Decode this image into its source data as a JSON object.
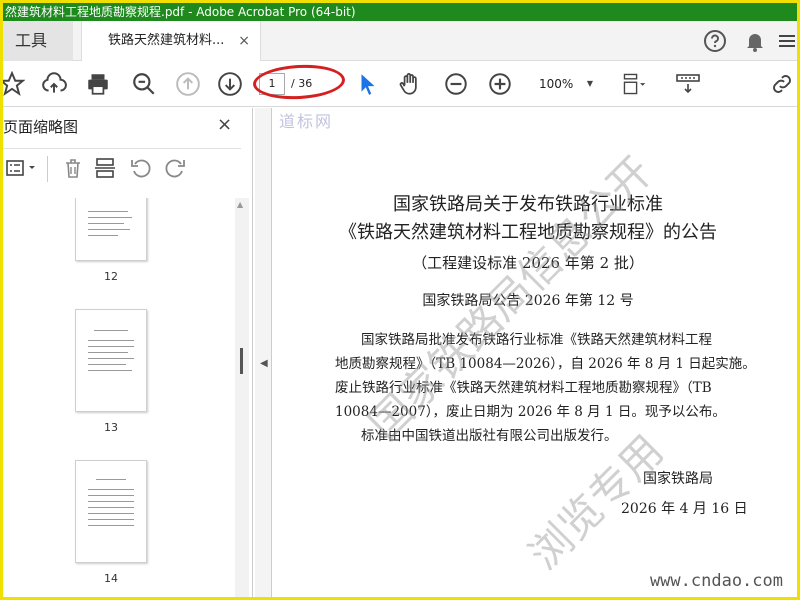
{
  "window": {
    "title": "然建筑材料工程地质勘察规程.pdf - Adobe Acrobat Pro (64-bit)"
  },
  "tabs": {
    "tools": "工具",
    "document": "铁路天然建筑材料...",
    "close_glyph": "×"
  },
  "toolbar": {
    "current_page": "1",
    "total_pages": "/ 36",
    "zoom": "100%"
  },
  "sidebar": {
    "title": "页面缩略图",
    "close_glyph": "×",
    "thumbnails": [
      {
        "label": "12"
      },
      {
        "label": "13"
      },
      {
        "label": "14"
      }
    ]
  },
  "document": {
    "title_line1": "国家铁路局关于发布铁路行业标准",
    "title_line2": "《铁路天然建筑材料工程地质勘察规程》的公告",
    "title_line3": "（工程建设标准 2026 年第 2 批）",
    "notice_no": "国家铁路局公告 2026 年第 12 号",
    "body_lines": [
      "国家铁路局批准发布铁路行业标准《铁路天然建筑材料工程",
      "地质勘察规程》（TB 10084—2026），自 2026 年 8 月 1 日起实施。",
      "废止铁路行业标准《铁路天然建筑材料工程地质勘察规程》（TB",
      "10084—2007），废止日期为 2026 年 8 月 1 日。现予以公布。",
      "标准由中国铁道出版社有限公司出版发行。"
    ],
    "issuer": "国家铁路局",
    "date": "2026 年 4 月 16 日",
    "watermark_line1": "国家铁路局信息公开",
    "watermark_line2": "浏览专用"
  },
  "site": {
    "url": "www.cndao.com",
    "logo": "道标网"
  },
  "colors": {
    "titlebar": "#1e8a1e",
    "frame": "#f0e000",
    "annotation_circle": "#d42020",
    "select_tool": "#1a73e8"
  }
}
